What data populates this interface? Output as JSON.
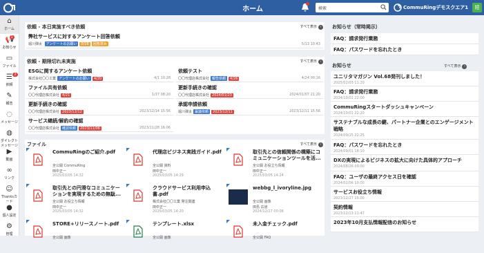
{
  "header": {
    "title": "ホーム",
    "search_placeholder": "検索",
    "org": "CommuRingデモスクエア1",
    "avatar": "短"
  },
  "sidebar": [
    {
      "label": "ホーム",
      "icon": "home-icon"
    },
    {
      "label": "お知らせ",
      "icon": "megaphone-icon",
      "badge": "1"
    },
    {
      "label": "ファイル",
      "icon": "folder-icon"
    },
    {
      "label": "依頼",
      "icon": "list-icon",
      "badge": "2"
    },
    {
      "label": "報告",
      "icon": "pencil-icon"
    },
    {
      "label": "メッセージ",
      "icon": "chat-icon"
    },
    {
      "label": "ダイレクトメッセージ",
      "icon": "dm-icon"
    },
    {
      "label": "動画",
      "icon": "play-icon"
    },
    {
      "label": "リンク",
      "icon": "link-icon"
    },
    {
      "label": "Thanksカード",
      "icon": "smile-icon"
    },
    {
      "label": "個人設定",
      "icon": "person-icon"
    },
    {
      "label": "管理",
      "icon": "gear-icon"
    }
  ],
  "show_all": "すべて表示",
  "today": {
    "heading": "依頼 - 本日実施すべき依頼",
    "items": [
      {
        "title": "弊社サービスに対するアンケート回答依頼",
        "user": "堀川弾太",
        "tag": "アンケートのお願い",
        "progress": "0/16",
        "status": "回答済み",
        "date": "5/13 10:43"
      }
    ]
  },
  "overdue": {
    "heading": "依頼 - 期限切れ未実施",
    "items": [
      {
        "title": "ESGに関するアンケート依頼",
        "company": "株式会社〇〇工業",
        "tag": "アンケートのお願い",
        "due": "4/20",
        "date": "4/1 10:28"
      },
      {
        "title": "依頼テスト",
        "company": "〇〇代理店株式会社",
        "tag": "報告依頼",
        "due": "4/26",
        "date": "4/24 00:16"
      },
      {
        "title": "ファイル共有依頼",
        "company": "〇〇代理店株式会社",
        "due": "4/21",
        "date": "1/17 08:20"
      },
      {
        "title": "更新手続きの確認",
        "company": "〇〇代理店株式会社",
        "due": "2024/01/23",
        "date": "2024/01/07 21:20"
      },
      {
        "title": "更新手続きの確認",
        "company": "〇〇代理店株式会社",
        "due": "2023/12/12",
        "date": "2023/12/14 15:56"
      },
      {
        "title": "承認申請依頼",
        "company": "堀川弾太",
        "tag": "稟議依頼",
        "due": "2023/12/11",
        "date": "2023/12/11 15:56"
      },
      {
        "title": "サービス継続/解約の確認",
        "company": "〇〇代理店株式会社",
        "tag": "確認依頼",
        "due": "2023/11/06",
        "date": "2023/11/28 16:06"
      }
    ]
  },
  "files": {
    "heading": "ファイル",
    "items": [
      {
        "name": "CommuRingのご紹介.pdf",
        "tag1": "全公開",
        "tag2": "CommuRing",
        "user": "田中正一",
        "date": "2025/03/05 14:32",
        "type": "pdf"
      },
      {
        "name": "代理店ビジネス実践ガイド.pdf",
        "tag1": "全公開",
        "tag2": "資料",
        "user": "田中正一",
        "date": "2025/03/05 14:29",
        "type": "pdf"
      },
      {
        "name": "取引先との信頼関係の構築にコミュニケーションツールを活...",
        "tag1": "全公開",
        "tag2": "お役立ち情報",
        "user": "田中正一",
        "date": "2025/03/05 14:24",
        "type": "pdf"
      },
      {
        "name": "取引先との円滑なコミュニケーションを実現するための無駄...",
        "tag1": "全公開",
        "tag2": "お役立ち情報",
        "user": "田中正一",
        "date": "2025/03/05 14:32",
        "type": "pdf"
      },
      {
        "name": "クラウドサービス利用申込書.pdf",
        "tag1": "株式会社〇〇工業",
        "tag2": "発注関連",
        "user": "田中正一",
        "date": "2025/03/05 14:20",
        "type": "pdf"
      },
      {
        "name": "webbg_l_ivoryline.jpg",
        "tag1": "全公開",
        "tag2": "画像",
        "user": "田島 広道",
        "date": "2024/12/27 00:06",
        "type": "img"
      },
      {
        "name": "STORE+リリースノート.pdf",
        "tag1": "全公開",
        "tag2": "画像",
        "user": "",
        "date": "",
        "type": "pdf"
      },
      {
        "name": "テンプレート.xlsx",
        "tag1": "全公開",
        "tag2": "画像",
        "user": "",
        "date": "",
        "type": "xls"
      },
      {
        "name": "未入金チェック.pdf",
        "tag1": "全公開",
        "tag2": "FAQ",
        "user": "",
        "date": "",
        "type": "pdf"
      }
    ]
  },
  "pinned": {
    "heading": "お知らせ（常時掲示）",
    "items": [
      "FAQ：請求発行業務",
      "FAQ：パスワードを忘れたとき"
    ]
  },
  "news": {
    "heading": "お知らせ",
    "items": [
      {
        "title": "ユニリタマガジン Vol.68発刊しました！",
        "date": "2025/02/03 11:20"
      },
      {
        "title": "FAQ：請求発行業務",
        "date": "2024/10/01 22:00"
      },
      {
        "title": "CommuRingスタートダッシュキャンペーン",
        "date": "2024/10/01 22:20"
      },
      {
        "title": "サステナブルな成長の鍵、パートナー企業とのエンゲージメント戦略",
        "date": "2024/09/15 22:25"
      },
      {
        "title": "FAQ：パスワードを忘れたとき",
        "date": "2024/09/01 18:10"
      },
      {
        "title": "DXの実現によるビジネスの拡大に向けた具体的アプローチ",
        "date": "2024/08/26 09:00"
      },
      {
        "title": "FAQ：ユーザの最終アクセス日を確認",
        "date": "2024/02/06 10:00"
      },
      {
        "title": "サービスお役立ち情報",
        "date": "2023/12/27 15:00"
      },
      {
        "title": "契約情報",
        "date": "2023/12/13 11:47"
      },
      {
        "title": "2023年10月支払情報配信のお知らせ",
        "date": ""
      }
    ]
  }
}
